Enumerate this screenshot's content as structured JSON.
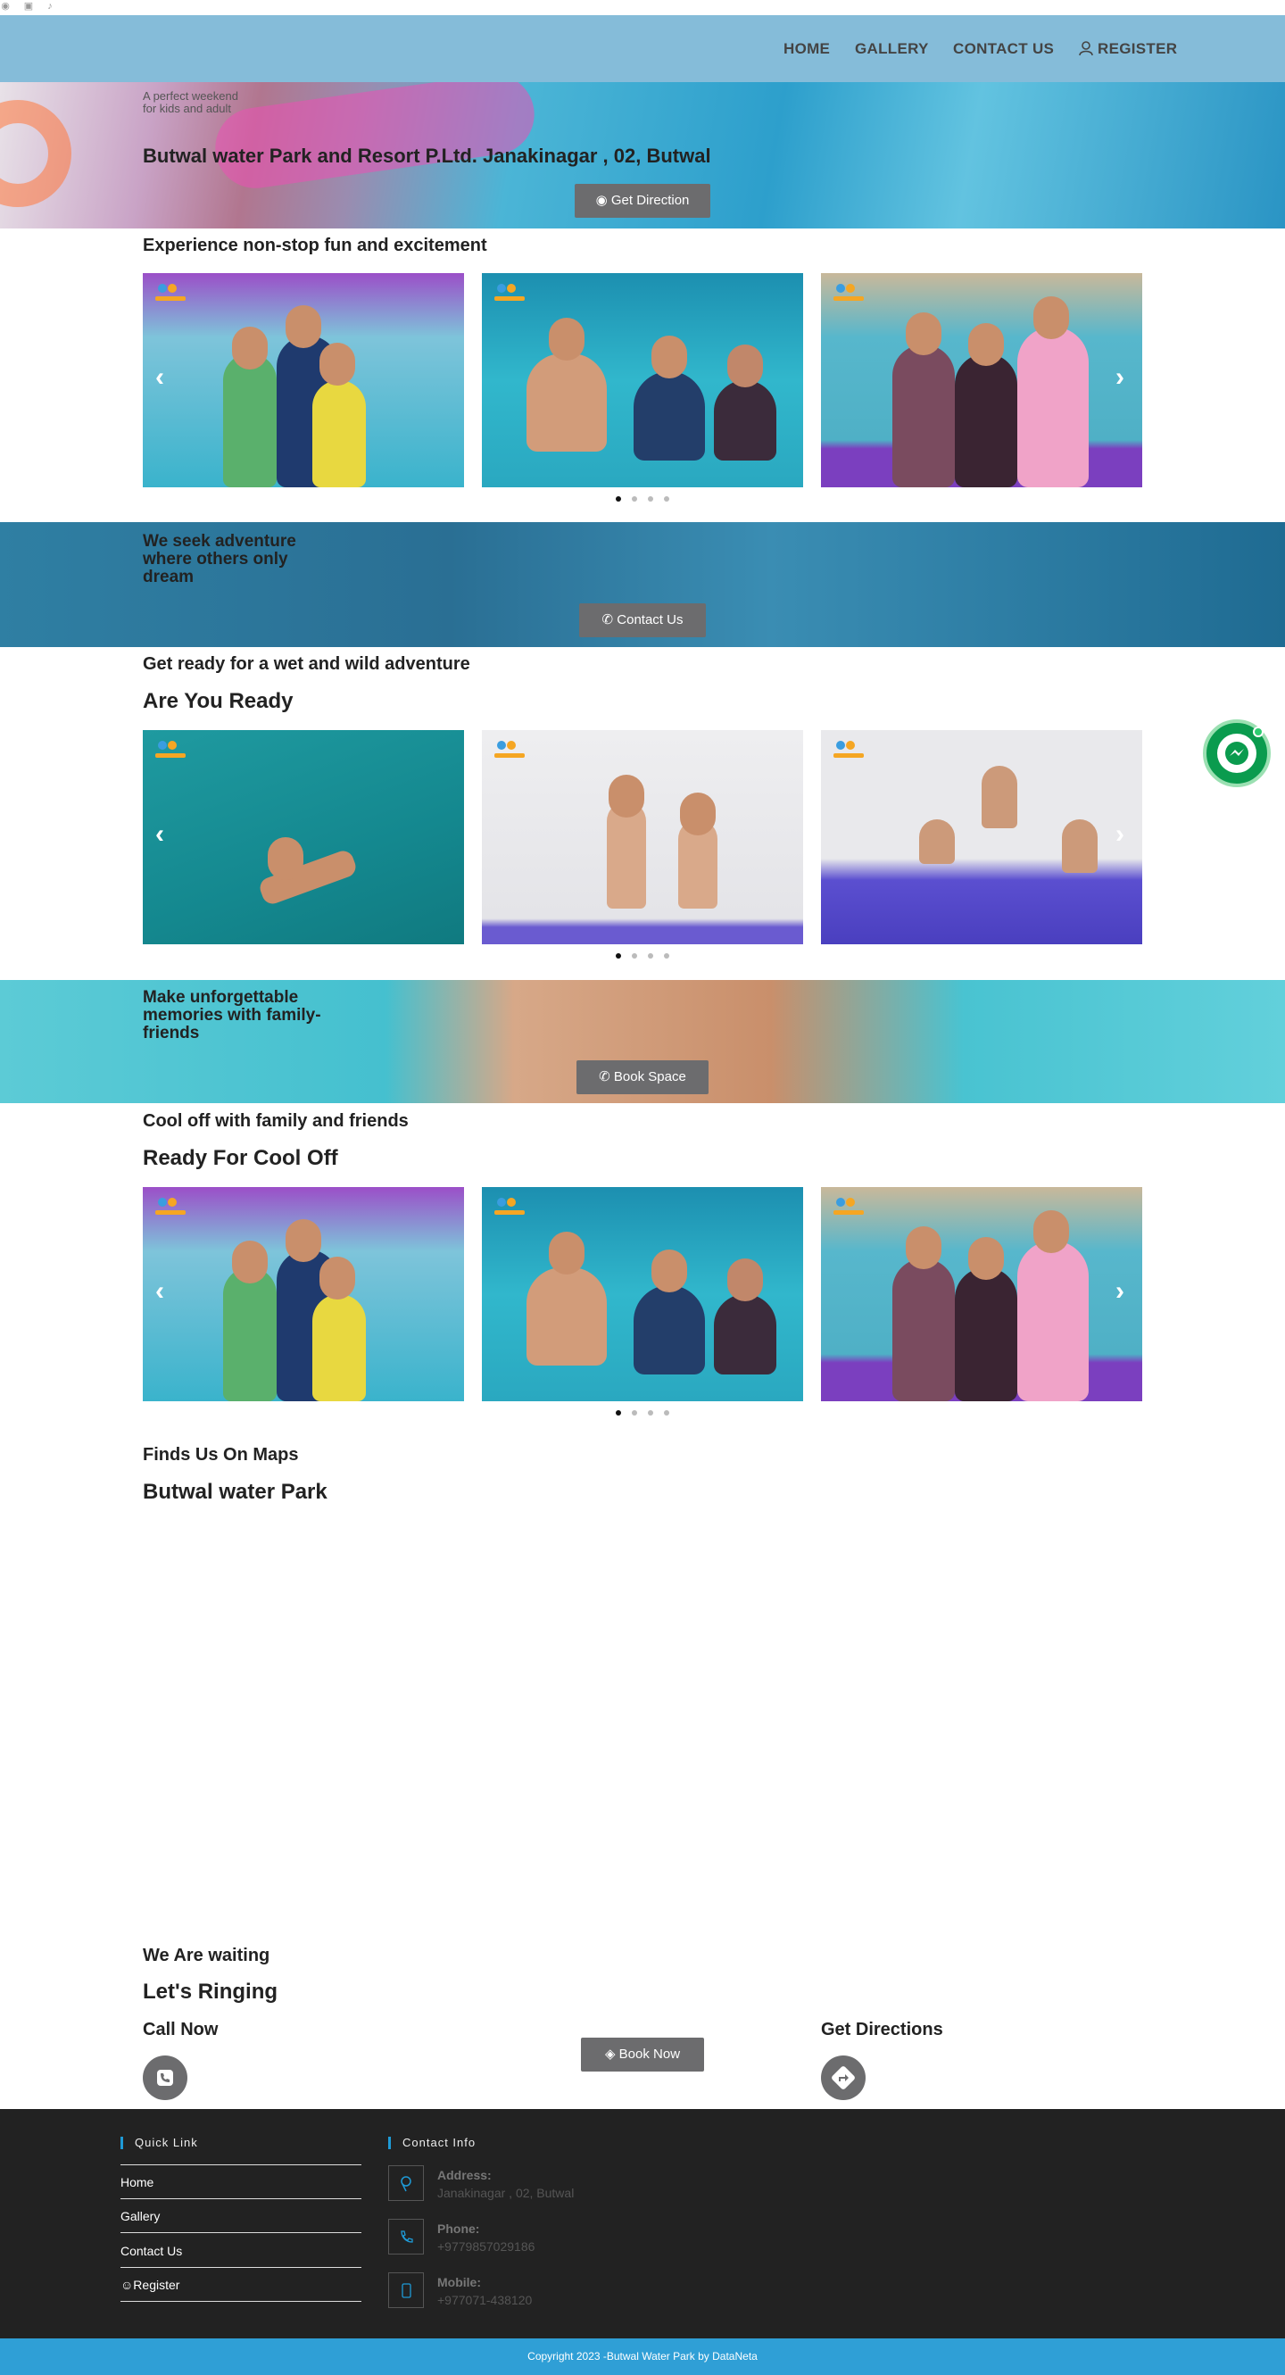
{
  "social": {
    "icons": [
      "facebook-icon",
      "instagram-icon",
      "tiktok-icon"
    ]
  },
  "nav": {
    "home": "HOME",
    "gallery": "GALLERY",
    "contact": "CONTACT US",
    "register": "REGISTER"
  },
  "hero": {
    "subtitle": "A perfect weekend for kids and adult",
    "title": "Butwal water Park and Resort P.Ltd. Janakinagar , 02, Butwal",
    "button": "Get Direction"
  },
  "section1": {
    "heading": "Experience non-stop fun and excitement"
  },
  "banner1": {
    "text": "We seek adventure where others only dream",
    "button": "Contact Us"
  },
  "section2": {
    "heading": "Get ready for a wet and wild adventure",
    "title": "Are You Ready"
  },
  "banner2": {
    "text": "Make unforgettable memories with family-friends",
    "button": "Book Space"
  },
  "section3": {
    "heading": "Cool off with family and friends",
    "title": "Ready For Cool Off"
  },
  "maps": {
    "heading": "Finds Us On Maps",
    "title": "Butwal water Park"
  },
  "ringing": {
    "heading": "We Are waiting",
    "title": "Let's Ringing",
    "call": "Call Now",
    "book": "Book Now",
    "directions": "Get Directions"
  },
  "footer": {
    "quick_link": "Quick Link",
    "links": [
      "Home",
      "Gallery",
      "Contact Us",
      "Register"
    ],
    "contact_info": "Contact Info",
    "address_label": "Address:",
    "address": "Janakinagar , 02, Butwal",
    "phone_label": "Phone:",
    "phone": "+9779857029186",
    "mobile_label": "Mobile:",
    "mobile": "+977071-438120"
  },
  "copyright": "Copyright 2023 -Butwal Water Park by DataNeta"
}
